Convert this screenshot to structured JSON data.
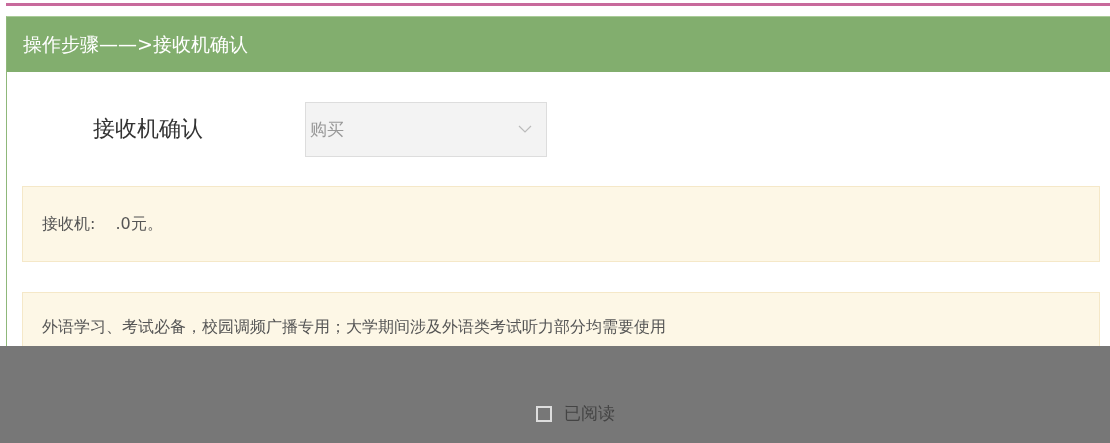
{
  "header": {
    "title": "操作步骤——>接收机确认"
  },
  "form": {
    "label": "接收机确认",
    "select": {
      "value": "购买",
      "disabled": true
    }
  },
  "price_notice": {
    "label": "接收机:",
    "value": ".0元。"
  },
  "usage_notice": {
    "text": "外语学习、考试必备，校园调频广播专用；大学期间涉及外语类考试听力部分均需要使用"
  },
  "overlay": {
    "checkbox": {
      "label": "已阅读",
      "checked": false
    }
  }
}
